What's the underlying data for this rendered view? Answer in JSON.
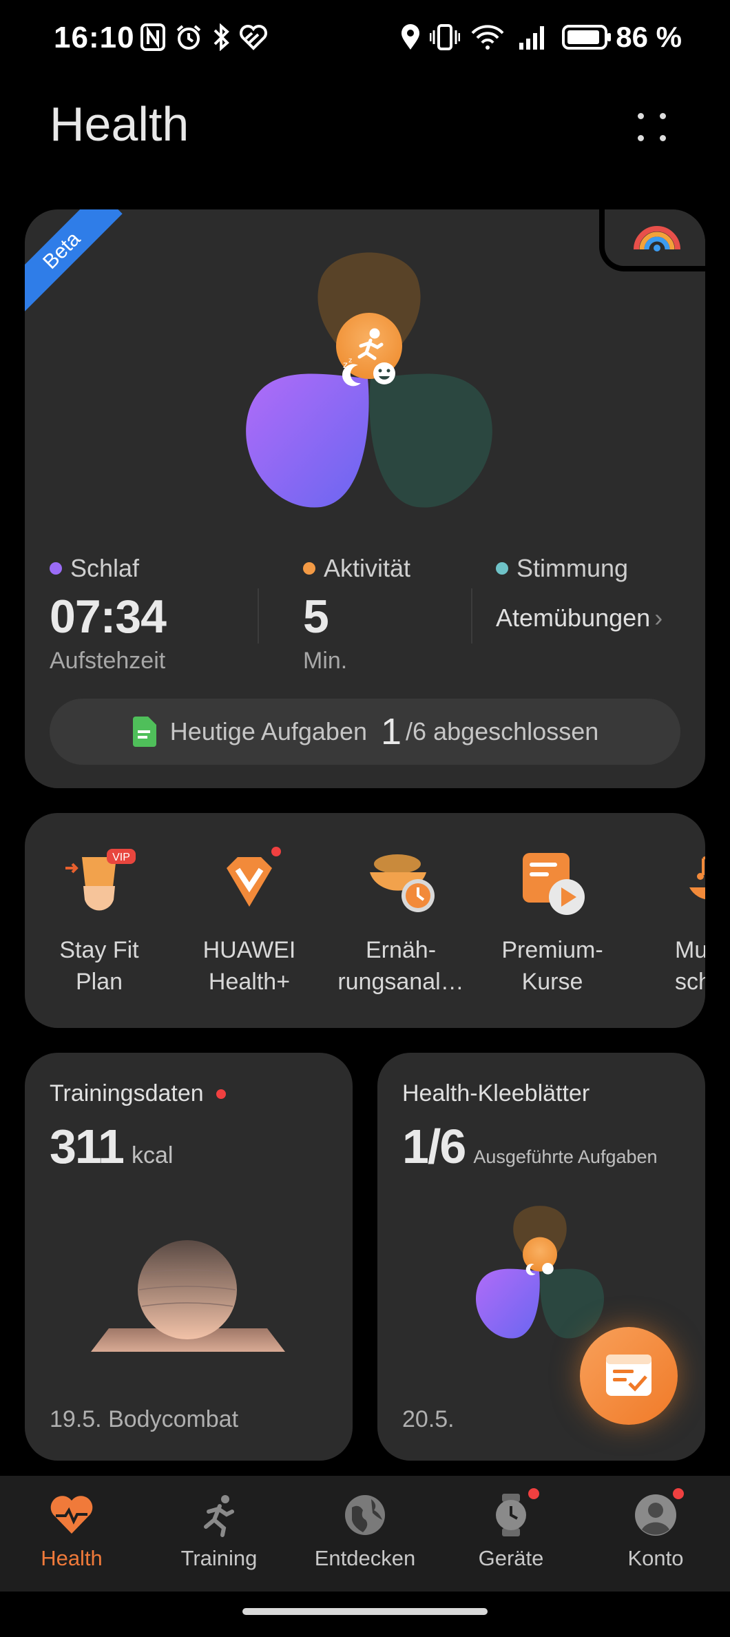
{
  "status_bar": {
    "time": "16:10",
    "battery": "86 %",
    "icons": [
      "nfc-icon",
      "alarm-icon",
      "bluetooth-icon",
      "health-app-icon",
      "location-icon",
      "vibrate-icon",
      "wifi-icon",
      "signal-icon",
      "battery-icon"
    ]
  },
  "header": {
    "title": "Health"
  },
  "main_card": {
    "badge": "Beta",
    "metrics": {
      "sleep": {
        "label": "Schlaf",
        "value": "07:34",
        "sub": "Aufstehzeit",
        "color": "#9b6cf7"
      },
      "activity": {
        "label": "Aktivität",
        "value": "5",
        "sub": "Min.",
        "color": "#f39a45"
      },
      "mood": {
        "label": "Stimmung",
        "link": "Atemübungen",
        "color": "#6fc3c8"
      }
    },
    "tasks": {
      "prefix": "Heutige Aufgaben",
      "done": "1",
      "suffix": "/6 abgeschlossen"
    }
  },
  "shortcuts": [
    {
      "label": "Stay Fit\nPlan",
      "icon": "stay-fit-vip-icon",
      "badge": "VIP"
    },
    {
      "label": "HUAWEI\nHealth+",
      "icon": "health-plus-icon"
    },
    {
      "label": "Ernäh-\nrungsanal…",
      "icon": "nutrition-analysis-icon"
    },
    {
      "label": "Premium-\nKurse",
      "icon": "premium-courses-icon"
    },
    {
      "label": "Musik\nschla",
      "icon": "sleep-music-icon"
    }
  ],
  "training_card": {
    "title": "Trainingsdaten",
    "value": "311",
    "unit": "kcal",
    "footer": "19.5. Bodycombat"
  },
  "clover_card": {
    "title": "Health-Kleeblätter",
    "value": "1/6",
    "unit": "Ausgeführte Aufgaben",
    "footer": "20.5."
  },
  "nav": [
    {
      "label": "Health",
      "icon": "heart-pulse-icon",
      "active": true
    },
    {
      "label": "Training",
      "icon": "running-person-icon"
    },
    {
      "label": "Entdecken",
      "icon": "globe-icon"
    },
    {
      "label": "Geräte",
      "icon": "watch-icon",
      "badge": true
    },
    {
      "label": "Konto",
      "icon": "account-icon",
      "badge": true
    }
  ],
  "colors": {
    "accent": "#f07a3a",
    "card": "#2c2c2c",
    "background": "#000000"
  }
}
